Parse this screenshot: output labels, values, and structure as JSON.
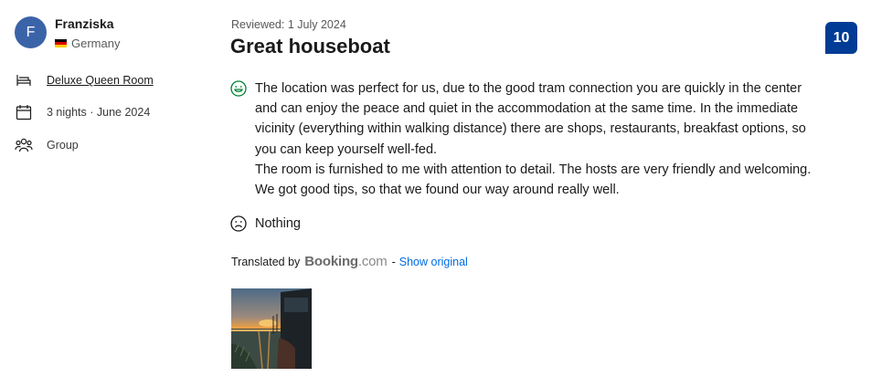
{
  "reviewer": {
    "initial": "F",
    "name": "Franziska",
    "country": "Germany"
  },
  "stay": {
    "room": "Deluxe Queen Room",
    "nights": "3 nights · June 2024",
    "traveller_type": "Group"
  },
  "review": {
    "date": "Reviewed: 1 July 2024",
    "title": "Great houseboat",
    "score": "10",
    "positive": "The location was perfect for us, due to the good tram connection you are quickly in the center\nand can enjoy the peace and quiet in the accommodation at the same time. In the immediate\nvicinity (everything within walking distance) there are shops, restaurants, breakfast options, so\nyou can keep yourself well-fed.\nThe room is furnished to me with attention to detail. The hosts are very friendly and welcoming.\nWe got good tips, so that we found our way around really well.",
    "negative": "Nothing"
  },
  "translation": {
    "prefix": "Translated by",
    "brand": "Booking",
    "brand_suffix": ".com",
    "separator": "-",
    "show_original": "Show original"
  },
  "icons": {
    "bed": "bed-icon",
    "calendar": "calendar-icon",
    "group": "group-icon",
    "positive": "smiley-icon",
    "negative": "sad-face-icon"
  },
  "colors": {
    "avatar": "#3b63a8",
    "score_badge": "#003b95",
    "link": "#006ce4",
    "positive_icon": "#008234",
    "flag": [
      "#000000",
      "#dd0000",
      "#ffce00"
    ]
  }
}
